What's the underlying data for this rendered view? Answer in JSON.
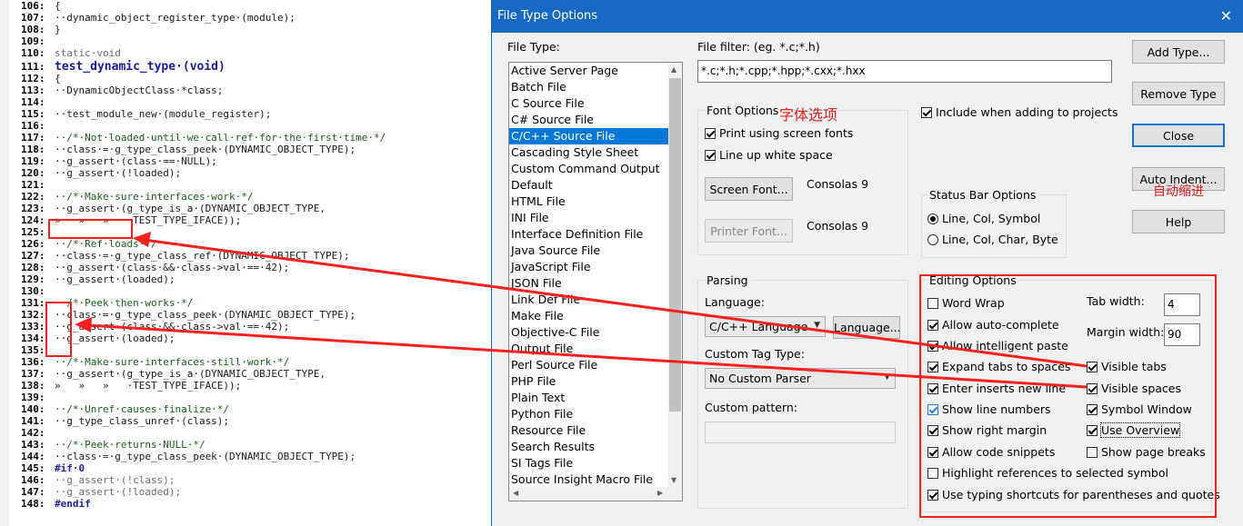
{
  "editor": {
    "lines": [
      {
        "n": "106:",
        "t": "{",
        "c": ""
      },
      {
        "n": "107:",
        "t": "··dynamic_object_register_type·(module);",
        "c": ""
      },
      {
        "n": "108:",
        "t": "}",
        "c": ""
      },
      {
        "n": "109:",
        "t": "",
        "c": ""
      },
      {
        "n": "110:",
        "t": "static·void",
        "c": "dim"
      },
      {
        "n": "111:",
        "t": "test_dynamic_type·(void)",
        "c": "fn"
      },
      {
        "n": "112:",
        "t": "{",
        "c": ""
      },
      {
        "n": "113:",
        "t": "··DynamicObjectClass·*class;",
        "c": ""
      },
      {
        "n": "114:",
        "t": "",
        "c": ""
      },
      {
        "n": "115:",
        "t": "··test_module_new·(module_register);",
        "c": ""
      },
      {
        "n": "116:",
        "t": "",
        "c": ""
      },
      {
        "n": "117:",
        "t": "··/*·Not·loaded·until·we·call·ref·for·the·first·time·*/",
        "c": "cm"
      },
      {
        "n": "118:",
        "t": "··class·=·g_type_class_peek·(DYNAMIC_OBJECT_TYPE);",
        "c": ""
      },
      {
        "n": "119:",
        "t": "··g_assert·(class·==·NULL);",
        "c": ""
      },
      {
        "n": "120:",
        "t": "··g_assert·(!loaded);",
        "c": ""
      },
      {
        "n": "121:",
        "t": "",
        "c": ""
      },
      {
        "n": "122:",
        "t": "··/*·Make·sure·interfaces·work·*/",
        "c": "cm"
      },
      {
        "n": "123:",
        "t": "··g_assert·(g_type_is_a·(DYNAMIC_OBJECT_TYPE,",
        "c": ""
      },
      {
        "n": "124:",
        "t": "»   »   »   ·TEST_TYPE_IFACE));",
        "c": ""
      },
      {
        "n": "125:",
        "t": "",
        "c": ""
      },
      {
        "n": "126:",
        "t": "··/*·Ref·loads·*/",
        "c": "cm"
      },
      {
        "n": "127:",
        "t": "··class·=·g_type_class_ref·(DYNAMIC_OBJECT_TYPE);",
        "c": ""
      },
      {
        "n": "128:",
        "t": "··g_assert·(class·&&·class->val·==·42);",
        "c": ""
      },
      {
        "n": "129:",
        "t": "··g_assert·(loaded);",
        "c": ""
      },
      {
        "n": "130:",
        "t": "",
        "c": ""
      },
      {
        "n": "131:",
        "t": "··/*·Peek·then·works·*/",
        "c": "cm"
      },
      {
        "n": "132:",
        "t": "··class·=·g_type_class_peek·(DYNAMIC_OBJECT_TYPE);",
        "c": ""
      },
      {
        "n": "133:",
        "t": "··g_assert·(class·&&·class->val·==·42);",
        "c": ""
      },
      {
        "n": "134:",
        "t": "··g_assert·(loaded);",
        "c": ""
      },
      {
        "n": "135:",
        "t": "",
        "c": ""
      },
      {
        "n": "136:",
        "t": "··/*·Make·sure·interfaces·still·work·*/",
        "c": "cm"
      },
      {
        "n": "137:",
        "t": "··g_assert·(g_type_is_a·(DYNAMIC_OBJECT_TYPE,",
        "c": ""
      },
      {
        "n": "138:",
        "t": "»   »   »   ·TEST_TYPE_IFACE));",
        "c": ""
      },
      {
        "n": "139:",
        "t": "",
        "c": ""
      },
      {
        "n": "140:",
        "t": "··/*·Unref·causes·finalize·*/",
        "c": "cm"
      },
      {
        "n": "141:",
        "t": "··g_type_class_unref·(class);",
        "c": ""
      },
      {
        "n": "142:",
        "t": "",
        "c": ""
      },
      {
        "n": "143:",
        "t": "··/*·Peek·returns·NULL·*/",
        "c": "cm"
      },
      {
        "n": "144:",
        "t": "··class·=·g_type_class_peek·(DYNAMIC_OBJECT_TYPE);",
        "c": ""
      },
      {
        "n": "145:",
        "t": "#if·0",
        "c": "pp"
      },
      {
        "n": "146:",
        "t": "··g_assert·(!class);",
        "c": "dim"
      },
      {
        "n": "147:",
        "t": "··g_assert·(!loaded);",
        "c": "dim"
      },
      {
        "n": "148:",
        "t": "#endif",
        "c": "pp"
      }
    ]
  },
  "dialog": {
    "title": "File Type Options",
    "close": "✕",
    "file_type_label": "File Type:",
    "file_types": [
      "Active Server Page",
      "Batch File",
      "C Source File",
      "C# Source File",
      "C/C++ Source File",
      "Cascading Style Sheet",
      "Custom Command Output",
      "Default",
      "HTML File",
      "INI File",
      "Interface Definition File",
      "Java Source File",
      "JavaScript File",
      "JSON File",
      "Link Def File",
      "Make File",
      "Objective-C File",
      "Output File",
      "Perl Source File",
      "PHP File",
      "Plain Text",
      "Python File",
      "Resource File",
      "Search Results",
      "SI Tags File",
      "Source Insight Macro File"
    ],
    "selected_index": 4,
    "file_filter_label": "File filter: (eg. *.c;*.h)",
    "file_filter_value": "*.c;*.h;*.cpp;*.hpp;*.cxx;*.hxx",
    "font_options_label": "Font Options",
    "font_options_note": "字体选项",
    "print_screen_fonts": "Print using screen fonts",
    "line_up_white": "Line up white space",
    "screen_font_button": "Screen Font...",
    "screen_font_value": "Consolas 9",
    "printer_font_button": "Printer Font...",
    "printer_font_value": "Consolas 9",
    "include_projects": "Include when adding to projects",
    "status_bar_label": "Status Bar Options",
    "status_opt1": "Line, Col, Symbol",
    "status_opt2": "Line, Col, Char, Byte",
    "parsing_label": "Parsing",
    "language_label": "Language:",
    "language_value": "C/C++ Language",
    "language_button": "Language...",
    "custom_tag_label": "Custom Tag Type:",
    "custom_tag_value": "No Custom Parser",
    "custom_pattern_label": "Custom pattern:",
    "custom_pattern_value": "",
    "buttons": {
      "add_type": "Add Type...",
      "remove_type": "Remove Type",
      "close": "Close",
      "auto_indent": "Auto Indent...",
      "help": "Help"
    },
    "auto_indent_note": "自动缩进",
    "editing": {
      "label": "Editing Options",
      "word_wrap": "Word Wrap",
      "auto_complete": "Allow auto-complete",
      "intelligent_paste": "Allow intelligent paste",
      "expand_tabs": "Expand tabs to spaces",
      "enter_inserts": "Enter inserts new line",
      "show_line_numbers": "Show line numbers",
      "show_right_margin": "Show right margin",
      "code_snippets": "Allow code snippets",
      "highlight_refs": "Highlight references to selected symbol",
      "typing_shortcuts": "Use typing shortcuts for parentheses and quotes",
      "tab_width_label": "Tab width:",
      "tab_width_value": "4",
      "margin_width_label": "Margin width:",
      "margin_width_value": "90",
      "visible_tabs": "Visible tabs",
      "visible_spaces": "Visible spaces",
      "symbol_window": "Symbol Window",
      "use_overview": "Use Overview",
      "show_page_breaks": "Show page breaks"
    }
  },
  "colors": {
    "titlebar": "#1769c4",
    "selection": "#0078d7",
    "annotation": "#ff2020"
  }
}
